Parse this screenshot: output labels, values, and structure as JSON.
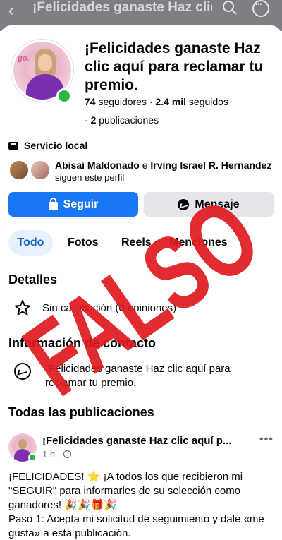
{
  "topbar": {
    "back_icon": "chevron-left-icon",
    "title": "¡Felicidades ganaste Haz clic aquí para reclamar tu premio.",
    "search_icon": "search-icon",
    "more_icon": "more-icon"
  },
  "profile": {
    "avatar_logo_text": "go.",
    "name": "¡Felicidades ganaste Haz clic aquí para reclamar tu premio.",
    "followers_count": "74",
    "followers_label": "seguidores",
    "separator": "·",
    "following_count": "2.4 mil",
    "following_label": "seguidos",
    "posts_prefix": "·",
    "posts_count": "2",
    "posts_label": "publicaciones",
    "status_color": "#2cb34a"
  },
  "category": {
    "icon": "briefcase-icon",
    "label": "Servicio local"
  },
  "mutual": {
    "friend1": "Abisai Maldonado",
    "connector": "e",
    "friend2": "Irving Israel R. Hernandez",
    "suffix": "siguen este perfil"
  },
  "actions": {
    "follow_label": "Seguir",
    "message_label": "Mensaje",
    "follow_color": "#1877f2"
  },
  "tabs": [
    {
      "label": "Todo",
      "active": true
    },
    {
      "label": "Fotos",
      "active": false
    },
    {
      "label": "Reels",
      "active": false
    },
    {
      "label": "Menciones",
      "active": false
    }
  ],
  "details": {
    "heading": "Detalles",
    "rating_text": "Sin calificación (0 opiniones)",
    "rating_icon": "star-icon"
  },
  "contact": {
    "heading": "Información de contacto",
    "icon": "messenger-icon",
    "text": "¡Felicidades ganaste Haz clic aquí para reclamar tu premio."
  },
  "posts": {
    "heading": "Todas las publicaciones",
    "items": [
      {
        "author": "¡Felicidades ganaste Haz clic aquí p...",
        "time": "1 h ·",
        "lines": [
          "¡FELICIDADES! ⭐ ¡A todos los que recibieron mi \"SEGUIR\" para informarles de su selección como ganadores! 🎉🎉🎁🎉",
          "Paso 1: Acepta mi solicitud de seguimiento y dale «me gusta» a esta publicación."
        ]
      }
    ]
  },
  "overlay": {
    "stamp_text": "FALSO",
    "stamp_color": "#e0181f"
  }
}
